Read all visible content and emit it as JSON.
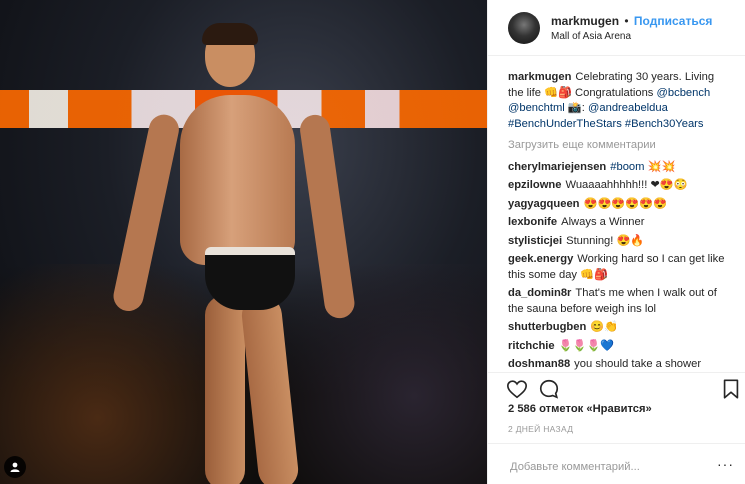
{
  "post": {
    "username": "markmugen",
    "separator": "•",
    "follow_label": "Подписаться",
    "location": "Mall of Asia Arena"
  },
  "caption": {
    "username": "markmugen",
    "text_1": "Celebrating 30 years. Living the life 👊🎒 Congratulations ",
    "mention_1": "@bcbench",
    "mention_2": "@benchtml",
    "text_2": " 📸: ",
    "mention_3": "@andreabeldua",
    "tag_1": "#BenchUnderTheStars",
    "tag_2": "#Bench30Years"
  },
  "load_more": "Загрузить еще комментарии",
  "comments": [
    {
      "user": "cherylmariejensen",
      "text": "",
      "tag": "#boom",
      "after": " 💥💥"
    },
    {
      "user": "epzilowne",
      "text": "Wuaaaahhhhh!!! ❤😍😳",
      "tag": "",
      "after": ""
    },
    {
      "user": "yagyagqueen",
      "text": "😍😍😍😍😍😍",
      "tag": "",
      "after": ""
    },
    {
      "user": "lexbonife",
      "text": "Always a Winner",
      "tag": "",
      "after": ""
    },
    {
      "user": "stylisticjei",
      "text": "Stunning! 😍🔥",
      "tag": "",
      "after": ""
    },
    {
      "user": "geek.energy",
      "text": "Working hard so I can get like this some day 👊🎒",
      "tag": "",
      "after": ""
    },
    {
      "user": "da_domin8r",
      "text": "That's me when I walk out of the sauna before weigh ins lol",
      "tag": "",
      "after": ""
    },
    {
      "user": "shutterbugben",
      "text": "😊👏",
      "tag": "",
      "after": ""
    },
    {
      "user": "ritchchie",
      "text": "🌷🌷🌷💙",
      "tag": "",
      "after": ""
    },
    {
      "user": "doshman88",
      "text": "you should take a shower",
      "tag": "",
      "after": ""
    }
  ],
  "likes_text": "2 586 отметок «Нравится»",
  "date_text": "2 ДНЕЙ НАЗАД",
  "comment_placeholder": "Добавьте комментарий...",
  "more_label": "···",
  "icons": {
    "like": "heart-icon",
    "comment": "speech-bubble-icon",
    "save": "bookmark-icon",
    "tag": "user-tag-icon"
  }
}
